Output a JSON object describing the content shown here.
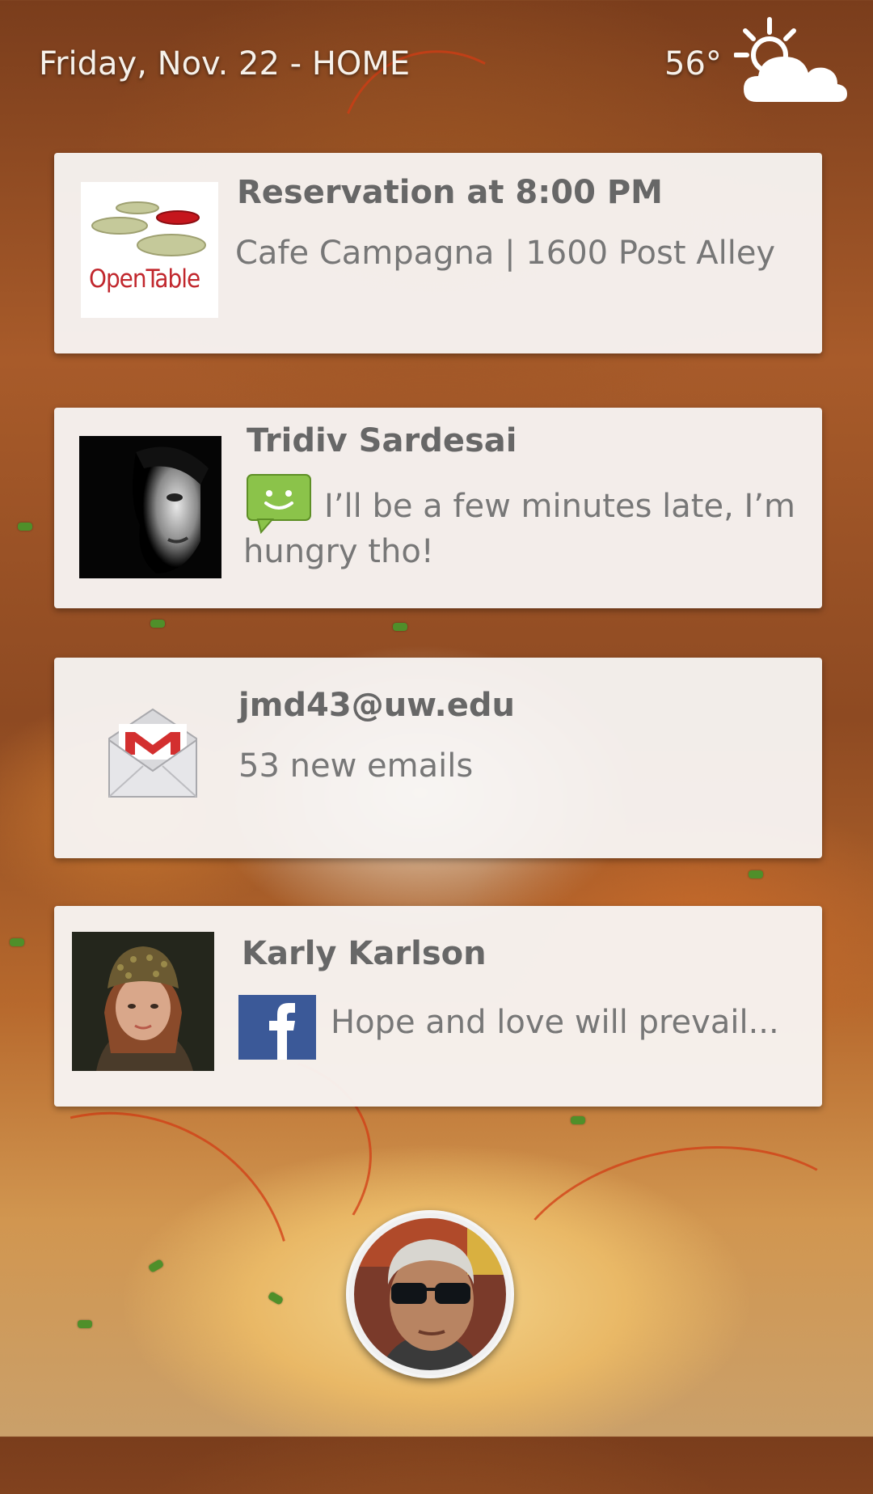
{
  "status_bar": {
    "date_location": "Friday, Nov. 22 - HOME",
    "temperature": "56°",
    "weather_icon": "partly-cloudy-icon"
  },
  "cards": {
    "reservation": {
      "app_icon": "opentable-logo",
      "logo_text": "OpenTable",
      "title": "Reservation at 8:00 PM",
      "detail": "Cafe Campagna | 1600 Post Alley"
    },
    "message": {
      "app_icon": "sms-icon",
      "title": "Tridiv Sardesai",
      "text": "I’ll be a few minutes late, I’m hungry tho!"
    },
    "email": {
      "app_icon": "gmail-icon",
      "title": "jmd43@uw.edu",
      "detail": "53 new emails"
    },
    "facebook": {
      "app_icon": "facebook-icon",
      "title": "Karly Karlson",
      "text": "Hope and love will prevail..."
    }
  },
  "colors": {
    "card_bg": "#f8f6f4",
    "title_text": "#676767",
    "body_text": "#777777",
    "opentable_red": "#c1272d",
    "facebook_blue": "#3b5998",
    "sms_green": "#8bc34a",
    "gmail_red": "#d32f2f"
  }
}
